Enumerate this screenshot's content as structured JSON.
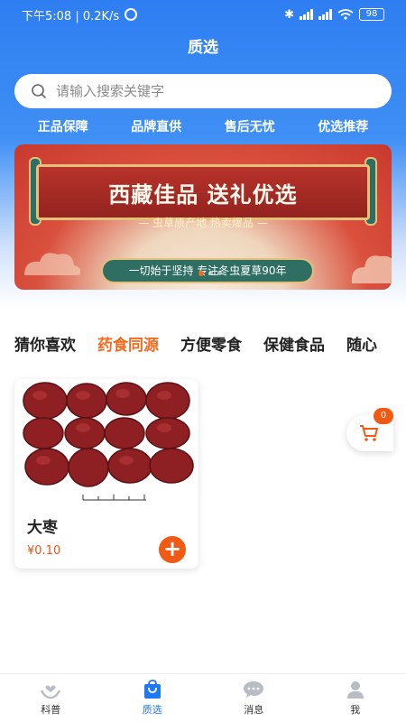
{
  "status_bar": {
    "time_text": "下午5:08 | 0.2K/s",
    "battery": "98"
  },
  "header": {
    "title": "质选"
  },
  "search": {
    "placeholder": "请输入搜索关键字"
  },
  "features": [
    "正品保障",
    "品牌直供",
    "售后无忧",
    "优选推荐"
  ],
  "banner": {
    "headline": "西藏佳品 送礼优选",
    "subline": "— 虫草原产地 热卖爆品 —",
    "slogan": "一切始于坚持 专注冬虫夏草90年",
    "slide_count": 3,
    "active_slide": 1
  },
  "tabs": [
    {
      "label": "猜你喜欢",
      "active": false
    },
    {
      "label": "药食同源",
      "active": true
    },
    {
      "label": "方便零食",
      "active": false
    },
    {
      "label": "保健食品",
      "active": false
    },
    {
      "label": "随心",
      "active": false
    }
  ],
  "products": [
    {
      "name": "大枣",
      "price": "¥0.10",
      "image_icon": "jujube-image"
    }
  ],
  "cart": {
    "count": "0"
  },
  "bottom_nav": [
    {
      "label": "科普",
      "icon": "hands-heart-icon",
      "active": false
    },
    {
      "label": "质选",
      "icon": "shopping-bag-icon",
      "active": true
    },
    {
      "label": "消息",
      "icon": "chat-bubble-icon",
      "active": false
    },
    {
      "label": "我",
      "icon": "user-icon",
      "active": false
    }
  ],
  "colors": {
    "brand_blue": "#2e7ef2",
    "accent_orange": "#f46a1f"
  }
}
